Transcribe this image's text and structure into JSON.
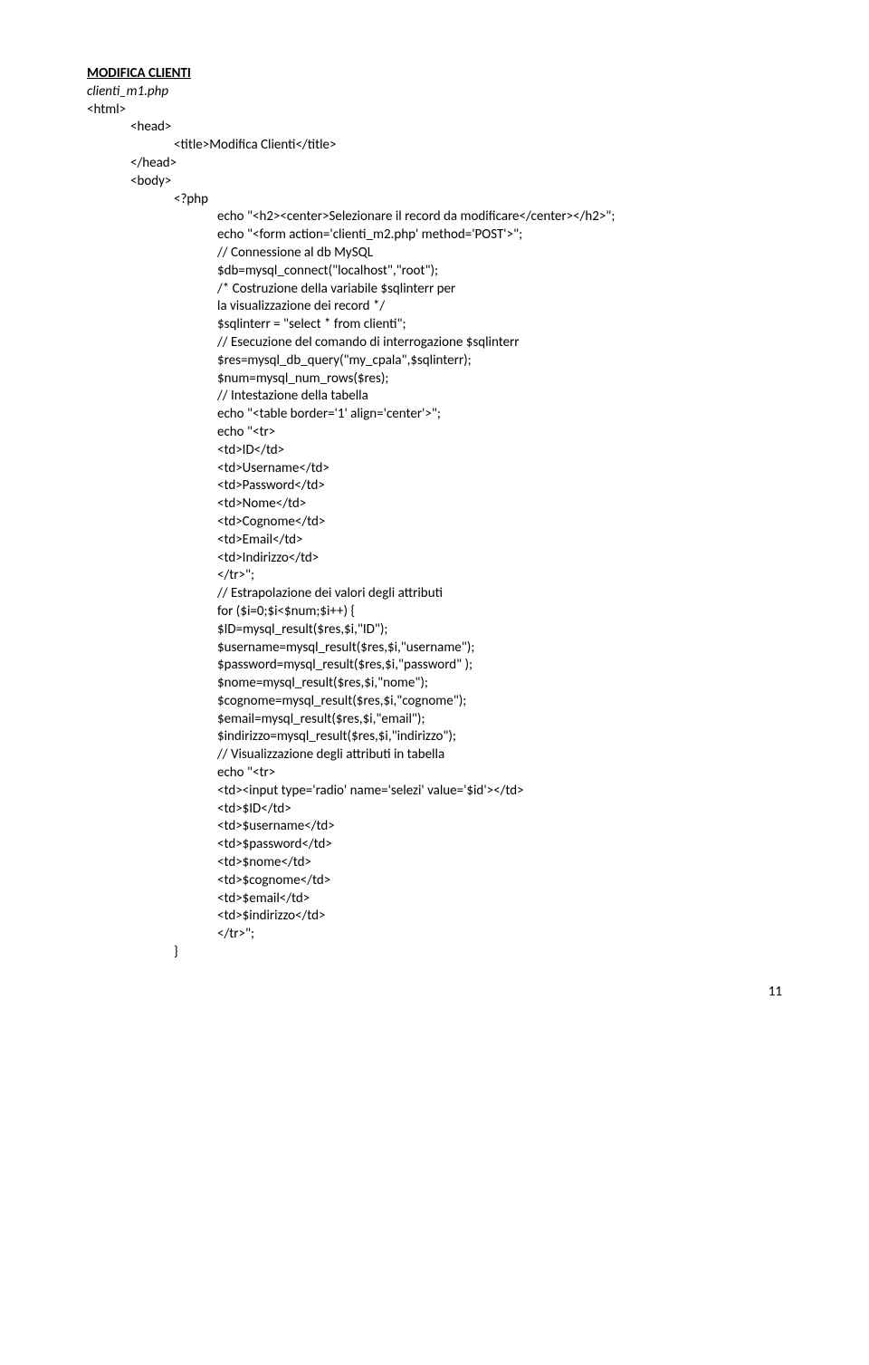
{
  "title": "MODIFICA CLIENTI",
  "filename": "clienti_m1.php",
  "lines": [
    {
      "cls": "",
      "txt": "<html>"
    },
    {
      "cls": "indent-1",
      "txt": "<head>"
    },
    {
      "cls": "indent-2",
      "txt": "<title>Modifica Clienti</title>"
    },
    {
      "cls": "indent-1",
      "txt": "</head>"
    },
    {
      "cls": "indent-1",
      "txt": "<body>"
    },
    {
      "cls": "indent-2",
      "txt": "<?php"
    },
    {
      "cls": "indent-3",
      "txt": "echo \"<h2><center>Selezionare il record da modificare</center></h2>\";"
    },
    {
      "cls": "indent-3",
      "txt": "echo \"<form action='clienti_m2.php' method='POST'>\";"
    },
    {
      "cls": "indent-3",
      "txt": "// Connessione al db MySQL"
    },
    {
      "cls": "indent-3",
      "txt": "$db=mysql_connect(\"localhost\",\"root\");"
    },
    {
      "cls": "indent-3",
      "txt": "/* Costruzione della variabile $sqlinterr per"
    },
    {
      "cls": "indent-3",
      "txt": "la visualizzazione dei record */"
    },
    {
      "cls": "indent-3",
      "txt": "$sqlinterr = \"select * from clienti\";"
    },
    {
      "cls": "indent-3",
      "txt": "// Esecuzione del comando di interrogazione $sqlinterr"
    },
    {
      "cls": "indent-3",
      "txt": "$res=mysql_db_query(\"my_cpala\",$sqlinterr);"
    },
    {
      "cls": "indent-3",
      "txt": "$num=mysql_num_rows($res);"
    },
    {
      "cls": "indent-3",
      "txt": "// Intestazione della tabella"
    },
    {
      "cls": "indent-3",
      "txt": "echo \"<table border='1' align='center'>\";"
    },
    {
      "cls": "indent-3",
      "txt": "echo \"<tr>"
    },
    {
      "cls": "indent-3",
      "txt": "<td>ID</td>"
    },
    {
      "cls": "indent-3",
      "txt": "<td>Username</td>"
    },
    {
      "cls": "indent-3",
      "txt": "<td>Password</td>"
    },
    {
      "cls": "indent-3",
      "txt": "<td>Nome</td>"
    },
    {
      "cls": "indent-3",
      "txt": "<td>Cognome</td>"
    },
    {
      "cls": "indent-3",
      "txt": "<td>Email</td>"
    },
    {
      "cls": "indent-3",
      "txt": "<td>Indirizzo</td>"
    },
    {
      "cls": "indent-3",
      "txt": "</tr>\";"
    },
    {
      "cls": "indent-3",
      "txt": "// Estrapolazione dei valori degli attributi"
    },
    {
      "cls": "indent-3",
      "txt": "for ($i=0;$i<$num;$i++) {"
    },
    {
      "cls": "indent-3",
      "txt": "$ID=mysql_result($res,$i,\"ID\");"
    },
    {
      "cls": "indent-3",
      "txt": "$username=mysql_result($res,$i,\"username\");"
    },
    {
      "cls": "indent-3",
      "txt": "$password=mysql_result($res,$i,\"password\" );"
    },
    {
      "cls": "indent-3",
      "txt": "$nome=mysql_result($res,$i,\"nome\");"
    },
    {
      "cls": "indent-3",
      "txt": "$cognome=mysql_result($res,$i,\"cognome\");"
    },
    {
      "cls": "indent-3",
      "txt": "$email=mysql_result($res,$i,\"email\");"
    },
    {
      "cls": "indent-3",
      "txt": "$indirizzo=mysql_result($res,$i,\"indirizzo\");"
    },
    {
      "cls": "indent-3",
      "txt": "// Visualizzazione degli attributi in tabella"
    },
    {
      "cls": "indent-3",
      "txt": "echo \"<tr>"
    },
    {
      "cls": "indent-3",
      "txt": "<td><input type='radio' name='selezi' value='$id'></td>"
    },
    {
      "cls": "indent-3",
      "txt": "<td>$ID</td>"
    },
    {
      "cls": "indent-3",
      "txt": "<td>$username</td>"
    },
    {
      "cls": "indent-3",
      "txt": "<td>$password</td>"
    },
    {
      "cls": "indent-3",
      "txt": "<td>$nome</td>"
    },
    {
      "cls": "indent-3",
      "txt": "<td>$cognome</td>"
    },
    {
      "cls": "indent-3",
      "txt": "<td>$email</td>"
    },
    {
      "cls": "indent-3",
      "txt": "<td>$indirizzo</td>"
    },
    {
      "cls": "indent-3",
      "txt": "</tr>\";"
    },
    {
      "cls": "indent-2",
      "txt": "}"
    }
  ],
  "page_number": "11"
}
